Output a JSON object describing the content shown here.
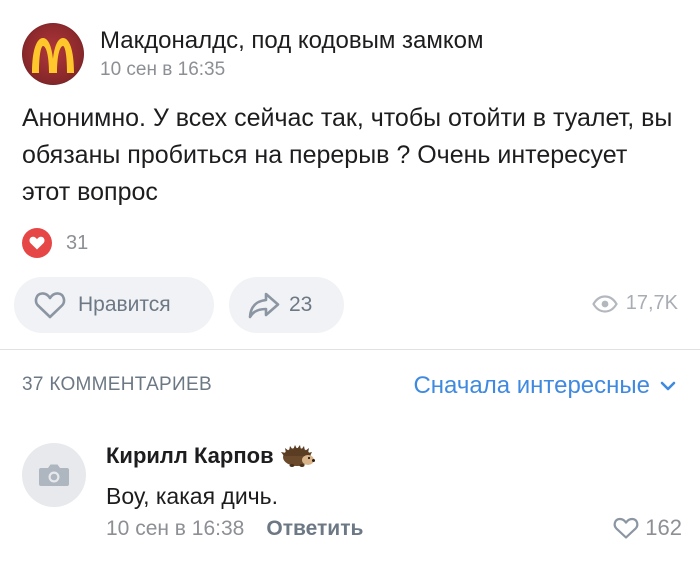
{
  "post": {
    "group_name": "Макдоналдс, под кодовым замком",
    "time": "10 сен в 16:35",
    "text": "Анонимно. У всех сейчас так, чтобы отойти в туалет, вы обязаны пробиться на перерыв ? Очень интересует этот вопрос",
    "reactions_count": "31",
    "like_label": "Нравится",
    "share_count": "23",
    "views": "17,7K"
  },
  "comments": {
    "header": "37 КОММЕНТАРИЕВ",
    "sort_label": "Сначала интересные",
    "items": [
      {
        "author": "Кирилл Карпов",
        "text": "Воу, какая дичь.",
        "time": "10 сен в 16:38",
        "reply_label": "Ответить",
        "likes": "162"
      }
    ]
  },
  "colors": {
    "accent": "#3f8ae0",
    "reaction_heart": "#e64646",
    "secondary_text": "#8c8f94",
    "pill_bg": "#f0f2f5",
    "mcd_red": "#b0363a",
    "mcd_yellow": "#ffc72c"
  },
  "icons": {
    "avatar": "mcdonalds-logo",
    "reaction": "heart-icon",
    "like": "heart-outline-icon",
    "share": "share-arrow-icon",
    "views": "eye-icon",
    "sort": "chevron-down-icon",
    "comment_avatar": "camera-icon",
    "author_badge": "hedgehog-icon",
    "comment_like": "heart-outline-icon"
  }
}
